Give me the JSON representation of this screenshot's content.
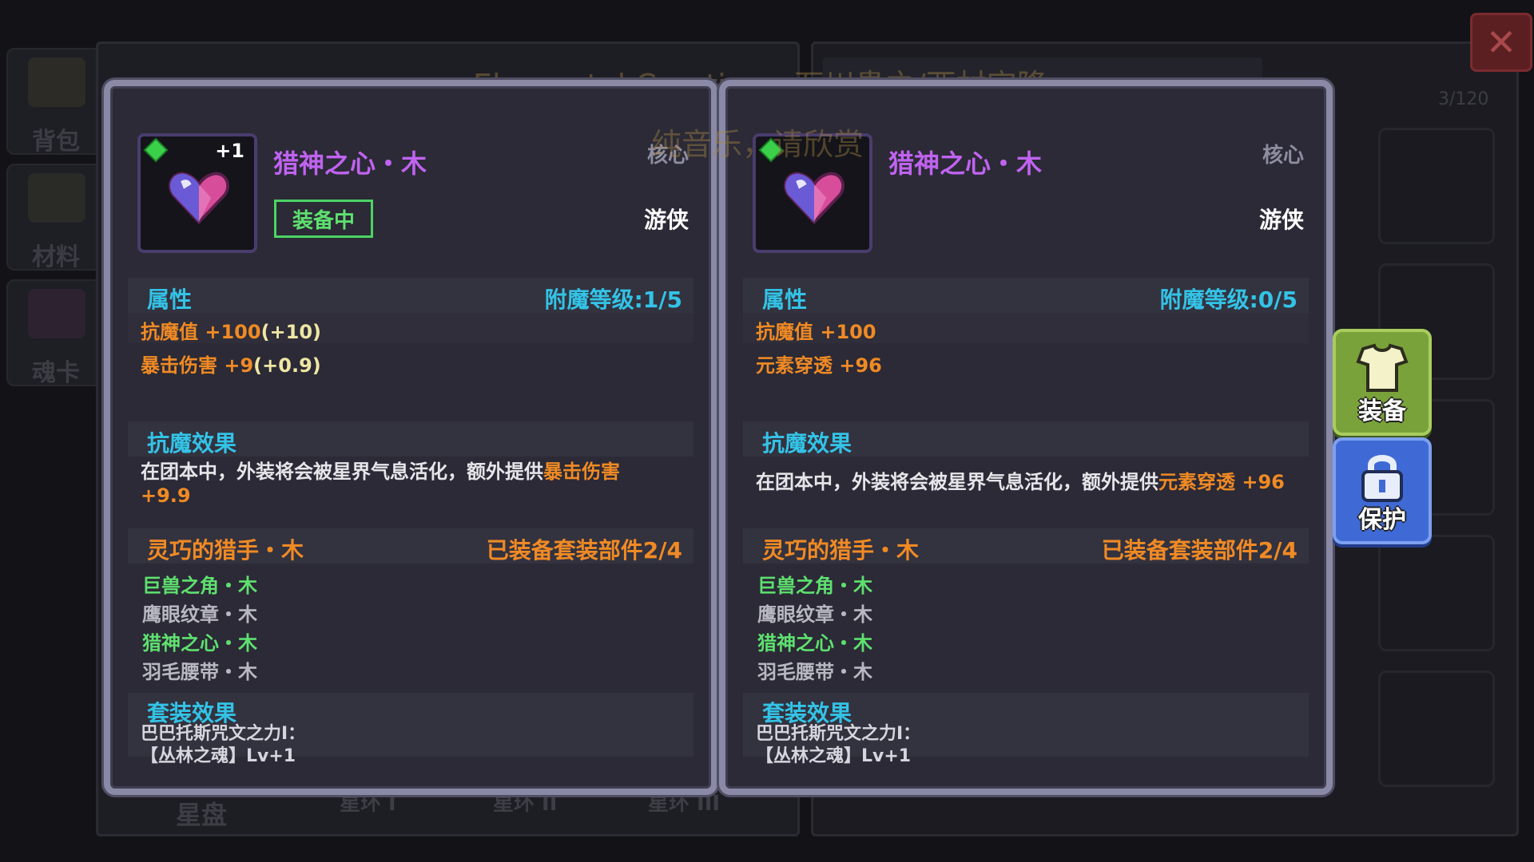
{
  "watermark": {
    "line1": "Elemental Creation - 石川贵之/西村宜隆",
    "line2": "纯音乐，请欣赏"
  },
  "background": {
    "sidebar": [
      "背包",
      "材料",
      "魂卡"
    ],
    "bottom_tabs": [
      "星盘",
      "星环 I",
      "星环 II",
      "星环 III"
    ],
    "count": "3/120",
    "close": "✕"
  },
  "left_card": {
    "plus": "+1",
    "name": "猎神之心・木",
    "type": "核心",
    "class": "游侠",
    "equipped": "装备中",
    "attr_title": "属性",
    "enchant": "附魔等级:1/5",
    "stats": [
      {
        "text": "抗魔值 +100",
        "bonus": "(+10)"
      },
      {
        "text": "暴击伤害 +9",
        "bonus": "(+0.9)"
      }
    ],
    "effect_title": "抗魔效果",
    "effect_text": "在团本中，外装将会被星界气息活化，额外提供",
    "effect_highlight": "暴击伤害",
    "effect_highlight2": "+9.9",
    "set_name": "灵巧的猎手・木",
    "set_count": "已装备套装部件2/4",
    "set_items": [
      "巨兽之角・木",
      "鹰眼纹章・木",
      "猎神之心・木",
      "羽毛腰带・木"
    ],
    "set_effect_title": "套装效果",
    "set_effect_line1": "巴巴托斯咒文之力Ⅰ：",
    "set_effect_line2": "【丛林之魂】Lv+1"
  },
  "right_card": {
    "name": "猎神之心・木",
    "type": "核心",
    "class": "游侠",
    "attr_title": "属性",
    "enchant": "附魔等级:0/5",
    "stats": [
      {
        "text": "抗魔值 +100"
      },
      {
        "text": "元素穿透 +96"
      }
    ],
    "effect_title": "抗魔效果",
    "effect_text": "在团本中，外装将会被星界气息活化，额外提供",
    "effect_highlight": "元素穿透 +96",
    "set_name": "灵巧的猎手・木",
    "set_count": "已装备套装部件2/4",
    "set_items": [
      "巨兽之角・木",
      "鹰眼纹章・木",
      "猎神之心・木",
      "羽毛腰带・木"
    ],
    "set_effect_title": "套装效果",
    "set_effect_line1": "巴巴托斯咒文之力Ⅰ：",
    "set_effect_line2": "【丛林之魂】Lv+1"
  },
  "actions": {
    "equip": "装备",
    "protect": "保护"
  },
  "colors": {
    "name_purple": "#c063f0",
    "accent_cyan": "#33c3e6",
    "stat_orange": "#f08a24",
    "set_green": "#5ee06f"
  }
}
